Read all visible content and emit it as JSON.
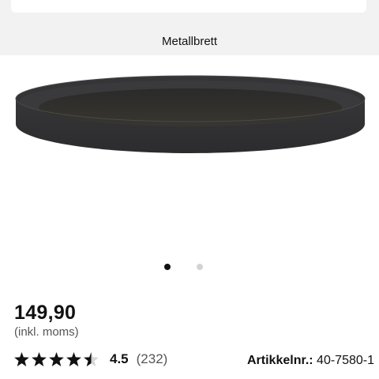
{
  "header": {
    "title": "Metallbrett"
  },
  "gallery": {
    "image_alt_icon": "tray-image",
    "dot_count": 2,
    "active_index": 0
  },
  "product": {
    "price": "149,90",
    "vat_note": "(inkl. moms)",
    "rating_value": "4.5",
    "rating_count": "(232)",
    "rating_stars": 4.5,
    "article_label": "Artikkelnr.:",
    "article_number": "40-7580-1"
  },
  "colors": {
    "star": "#111111",
    "header_bg": "#f2f2f2",
    "dot_active": "#111111",
    "dot_inactive": "#d3d3d3"
  }
}
